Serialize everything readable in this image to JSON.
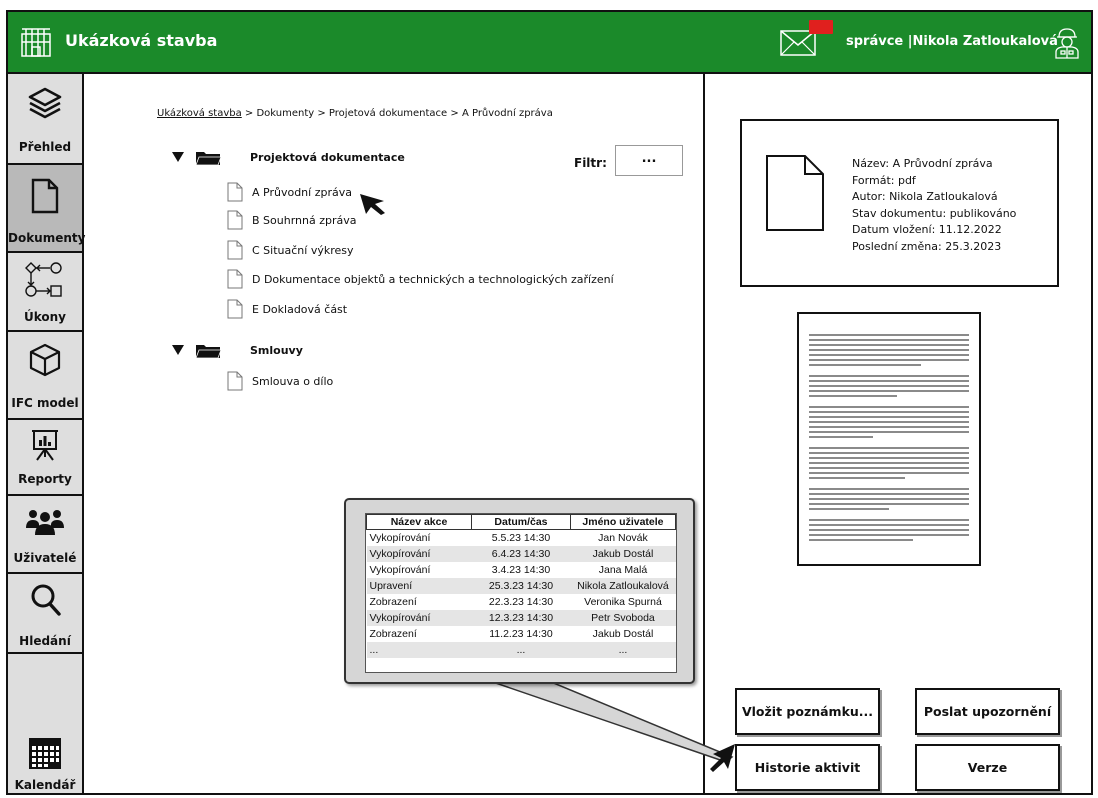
{
  "header": {
    "app_title": "Ukázková stavba",
    "mail_badge": "",
    "user_role": "správce",
    "user_name": "Nikola Zatloukalová",
    "user_text": "správce |Nikola Zatloukalová"
  },
  "sidebar": {
    "items": [
      {
        "label": "Přehled",
        "icon": "layers-icon"
      },
      {
        "label": "Dokumenty",
        "icon": "document-icon",
        "active": true
      },
      {
        "label": "Úkony",
        "icon": "workflow-icon"
      },
      {
        "label": "IFC model",
        "icon": "cube-icon"
      },
      {
        "label": "Reporty",
        "icon": "presentation-icon"
      },
      {
        "label": "Uživatelé",
        "icon": "users-icon"
      },
      {
        "label": "Hledání",
        "icon": "search-icon"
      },
      {
        "label": "Kalendář",
        "icon": "calendar-icon"
      }
    ]
  },
  "breadcrumb": {
    "root": "Ukázková stavba",
    "rest": " > Dokumenty > Projetová dokumentace > A Průvodní zpráva"
  },
  "filter": {
    "label": "Filtr:",
    "value": "..."
  },
  "tree": {
    "folders": [
      {
        "label": "Projektová dokumentace",
        "docs": [
          "A Průvodní zpráva",
          "B Souhrnná zpráva",
          "C Situační výkresy",
          "D Dokumentace objektů a technických a technologických zařízení",
          "E Dokladová část"
        ]
      },
      {
        "label": "Smlouvy",
        "docs": [
          "Smlouva o dílo"
        ]
      }
    ]
  },
  "activity": {
    "headers": [
      "Název akce",
      "Datum/čas",
      "Jméno uživatele"
    ],
    "rows": [
      [
        "Vykopírování",
        "5.5.23 14:30",
        "Jan Novák"
      ],
      [
        "Vykopírování",
        "6.4.23 14:30",
        "Jakub Dostál"
      ],
      [
        "Vykopírování",
        "3.4.23 14:30",
        "Jana Malá"
      ],
      [
        "Upravení",
        "25.3.23 14:30",
        "Nikola Zatloukalová"
      ],
      [
        "Zobrazení",
        "22.3.23 14:30",
        "Veronika Spurná"
      ],
      [
        "Vykopírování",
        "12.3.23 14:30",
        "Petr Svoboda"
      ],
      [
        "Zobrazení",
        "11.2.23 14:30",
        "Jakub Dostál"
      ],
      [
        "...",
        "...",
        "..."
      ]
    ]
  },
  "document_info": {
    "lines": [
      "Název: A Průvodní zpráva",
      "Formát: pdf",
      "Autor: Nikola Zatloukalová",
      "Stav dokumentu: publikováno",
      "Datum vložení: 11.12.2022",
      "Poslední změna: 25.3.2023"
    ]
  },
  "buttons": {
    "add_note": "Vložit poznámku...",
    "send_notification": "Poslat upozornění",
    "activity_history": "Historie aktivit",
    "versions": "Verze"
  },
  "colors": {
    "header_bg": "#1b8a2a",
    "badge": "#e0201e",
    "sidebar_active": "#b9b9b9"
  }
}
